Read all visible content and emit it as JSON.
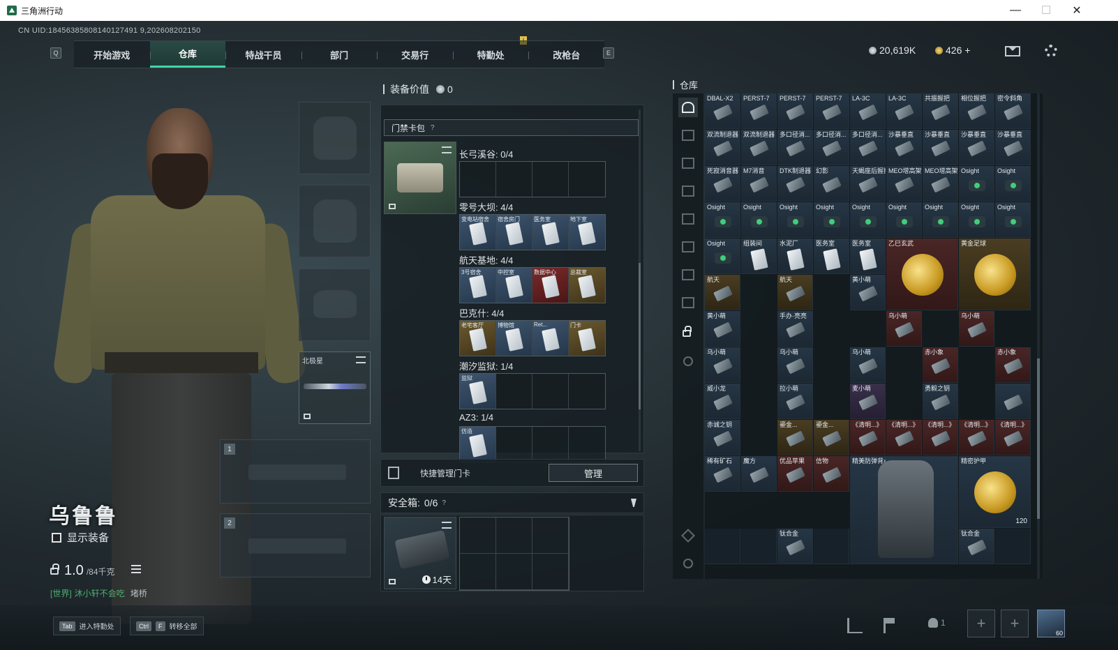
{
  "window": {
    "title": "三角洲行动",
    "minimize": "—",
    "maximize": "☐",
    "close": "✕"
  },
  "uid": "CN UID:18456385808140127491 9,202608202150",
  "nav": {
    "left_key": "Q",
    "right_key": "E",
    "marker": "!",
    "tabs": [
      {
        "label": "开始游戏"
      },
      {
        "label": "仓库"
      },
      {
        "label": "特战干员"
      },
      {
        "label": "部门"
      },
      {
        "label": "交易行"
      },
      {
        "label": "特勤处"
      },
      {
        "label": "改枪台"
      }
    ],
    "active_tab": "仓库"
  },
  "currency": {
    "coins": "20,619K",
    "tickets": "426",
    "add": "+"
  },
  "character": {
    "name": "乌鲁鲁",
    "show_equipment": "显示装备",
    "weight": "1.0",
    "weight_max": "/84千克",
    "chat": {
      "channel": "[世界]",
      "sender": "沐小轩不会吃",
      "message": "堵桥"
    }
  },
  "equipment": {
    "melee_label": "北极星",
    "weapon1": "1",
    "weapon2": "2"
  },
  "middle": {
    "equip_value_label": "装备价值",
    "equip_value": "0",
    "keycard_title": "门禁卡包",
    "help": "?",
    "groups": [
      {
        "label": "长弓溪谷: 0/4",
        "cells": [
          {
            "type": "empty",
            "name": ""
          },
          {
            "type": "empty",
            "name": ""
          },
          {
            "type": "empty",
            "name": ""
          },
          {
            "type": "empty",
            "name": ""
          }
        ]
      },
      {
        "label": "零号大坝: 4/4",
        "cells": [
          {
            "type": "card",
            "name": "变电站宿舍"
          },
          {
            "type": "card",
            "name": "宿舍房门"
          },
          {
            "type": "card",
            "name": "医务室"
          },
          {
            "type": "card",
            "name": "地下室"
          }
        ]
      },
      {
        "label": "航天基地: 4/4",
        "cells": [
          {
            "type": "card",
            "name": "3号宿舍"
          },
          {
            "type": "card",
            "name": "中控室"
          },
          {
            "type": "red",
            "name": "数据中心"
          },
          {
            "type": "gold",
            "name": "总裁室"
          }
        ]
      },
      {
        "label": "巴克什: 4/4",
        "cells": [
          {
            "type": "gold",
            "name": "老宅客厅"
          },
          {
            "type": "card",
            "name": "博物馆"
          },
          {
            "type": "card",
            "name": "Ret..."
          },
          {
            "type": "gold",
            "name": "门卡"
          }
        ]
      },
      {
        "label": "潮汐监狱: 1/4",
        "cells": [
          {
            "type": "card",
            "name": "监狱"
          },
          {
            "type": "empty",
            "name": ""
          },
          {
            "type": "empty",
            "name": ""
          },
          {
            "type": "empty",
            "name": ""
          }
        ]
      },
      {
        "label": "AZ3: 1/4",
        "cells": [
          {
            "type": "card",
            "name": "仿造"
          },
          {
            "type": "empty",
            "name": ""
          },
          {
            "type": "empty",
            "name": ""
          },
          {
            "type": "empty",
            "name": ""
          }
        ]
      }
    ],
    "quick_manage": "快捷管理门卡",
    "manage_button": "管理",
    "safe_label": "安全箱:",
    "safe_count": "0/6",
    "safe_days": "14天"
  },
  "storage": {
    "title": "仓库",
    "items": [
      {
        "name": "DBAL-X2",
        "style": ""
      },
      {
        "name": "PERST-7",
        "style": ""
      },
      {
        "name": "PERST-7",
        "style": ""
      },
      {
        "name": "PERST-7",
        "style": ""
      },
      {
        "name": "LA-3C",
        "style": ""
      },
      {
        "name": "LA-3C",
        "style": ""
      },
      {
        "name": "共振握把",
        "style": ""
      },
      {
        "name": "相位握把",
        "style": ""
      },
      {
        "name": "密令斜角",
        "style": ""
      },
      {
        "name": "双流制退器",
        "style": ""
      },
      {
        "name": "双流制退器",
        "style": ""
      },
      {
        "name": "多口径消...",
        "style": ""
      },
      {
        "name": "多口径消...",
        "style": ""
      },
      {
        "name": "多口径消...",
        "style": ""
      },
      {
        "name": "沙暴垂直",
        "style": ""
      },
      {
        "name": "沙暴垂直",
        "style": ""
      },
      {
        "name": "沙暴垂直",
        "style": ""
      },
      {
        "name": "沙暴垂直",
        "style": ""
      },
      {
        "name": "死寂消音器",
        "style": ""
      },
      {
        "name": "M7消音",
        "style": ""
      },
      {
        "name": "DTK制退器",
        "style": ""
      },
      {
        "name": "幻影",
        "style": ""
      },
      {
        "name": "天蝎座后握把",
        "style": ""
      },
      {
        "name": "MEO增高架",
        "style": ""
      },
      {
        "name": "MEO增高架",
        "style": ""
      },
      {
        "name": "Osight",
        "style": "green"
      },
      {
        "name": "Osight",
        "style": "green"
      },
      {
        "name": "Osight",
        "style": "green"
      },
      {
        "name": "Osight",
        "style": "green"
      },
      {
        "name": "Osight",
        "style": "green"
      },
      {
        "name": "Osight",
        "style": "green"
      },
      {
        "name": "Osight",
        "style": "green"
      },
      {
        "name": "Osight",
        "style": "green"
      },
      {
        "name": "Osight",
        "style": "green"
      },
      {
        "name": "Osight",
        "style": "green"
      },
      {
        "name": "Osight",
        "style": "green"
      },
      {
        "name": "Osight",
        "style": "green"
      },
      {
        "name": "组装间",
        "style": "card"
      },
      {
        "name": "水泥厂",
        "style": "card"
      },
      {
        "name": "医务室",
        "style": "card"
      },
      {
        "name": "医务室",
        "style": "card"
      }
    ],
    "big_items": [
      {
        "name": "乙巳玄武",
        "style": "red"
      },
      {
        "name": "黄金足球",
        "style": "gold"
      }
    ],
    "row6": [
      {
        "name": "航天",
        "style": "gold"
      },
      {
        "name": "航天",
        "style": "gold"
      },
      {
        "name": "黄小萌",
        "style": ""
      }
    ],
    "toys": [
      {
        "name": "黄小萌",
        "style": ""
      },
      {
        "name": "手办·亮亮",
        "style": ""
      },
      {
        "name": "乌小萌",
        "style": "red"
      },
      {
        "name": "乌小萌",
        "style": "red"
      },
      {
        "name": "乌小萌",
        "style": ""
      },
      {
        "name": "乌小萌",
        "style": ""
      },
      {
        "name": "乌小萌",
        "style": ""
      },
      {
        "name": "赤小象",
        "style": "red"
      },
      {
        "name": "赤小象",
        "style": "red"
      },
      {
        "name": "威小龙",
        "style": ""
      },
      {
        "name": "拉小萌",
        "style": ""
      },
      {
        "name": "麦小萌",
        "style": "purple"
      },
      {
        "name": "勇毅之钥",
        "style": ""
      },
      {
        "name": "",
        "style": ""
      },
      {
        "name": "赤诚之钥",
        "style": ""
      },
      {
        "name": "鎏金...",
        "style": "gold"
      },
      {
        "name": "鎏金...",
        "style": "gold"
      },
      {
        "name": "《清明...》",
        "style": "red"
      },
      {
        "name": "《清明...》",
        "style": "red"
      },
      {
        "name": "《清明...》",
        "style": "red"
      },
      {
        "name": "《清明...》",
        "style": "red"
      },
      {
        "name": "《清明...》",
        "style": "red"
      },
      {
        "name": "稀有矿石",
        "style": ""
      },
      {
        "name": "魔方",
        "style": ""
      },
      {
        "name": "优品苹果",
        "style": "red"
      },
      {
        "name": "信物",
        "style": "red"
      },
      {
        "name": "精美防弹背心 阿萨拉",
        "style": ""
      },
      {
        "name": "精密护甲",
        "style": ""
      }
    ],
    "vest_name": "精美防弹背心 阿萨拉",
    "armor_name": "精密护甲",
    "armor_count": "120",
    "ti_alloy": "钛合金",
    "ti_alloy2": "钛合金"
  },
  "bottom": {
    "hotkey1_key": "Tab",
    "hotkey1_label": "进入特勤处",
    "hotkey2_key1": "Ctrl",
    "hotkey2_key2": "F",
    "hotkey2_label": "转移全部",
    "friends": "1",
    "plus": "+",
    "level": "60"
  }
}
